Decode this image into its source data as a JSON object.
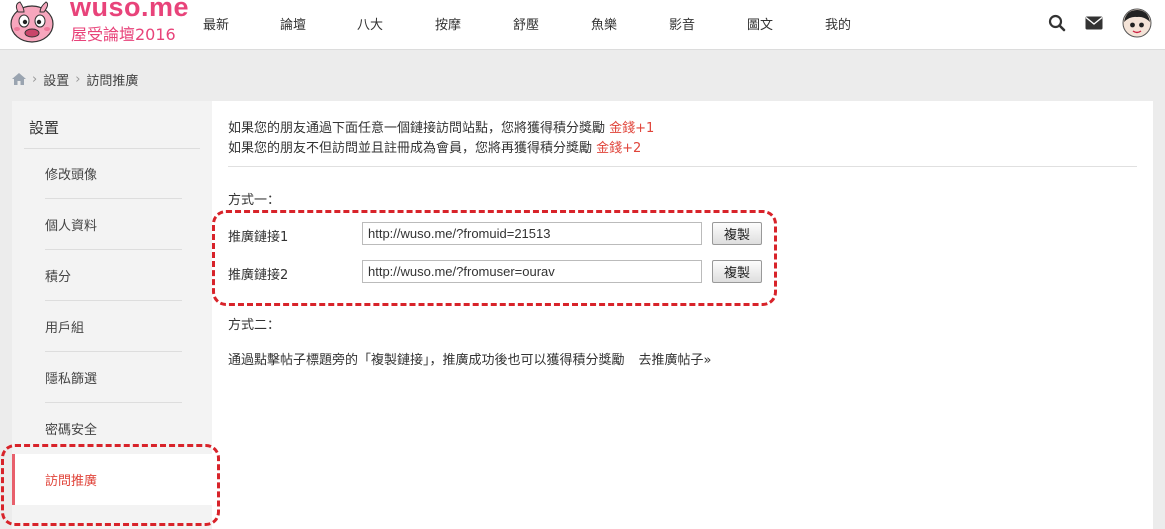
{
  "header": {
    "logo_text": "wuso.me",
    "logo_tagline": "屋受論壇2016",
    "nav": [
      "最新",
      "論壇",
      "八大",
      "按摩",
      "舒壓",
      "魚樂",
      "影音",
      "圖文",
      "我的"
    ],
    "icons": [
      "search-icon",
      "mail-icon",
      "avatar"
    ]
  },
  "breadcrumb": {
    "home_icon": "home-icon",
    "items": [
      "設置",
      "訪問推廣"
    ]
  },
  "sidebar": {
    "title": "設置",
    "items": [
      "修改頭像",
      "個人資料",
      "積分",
      "用戶組",
      "隱私篩選",
      "密碼安全",
      "訪問推廣"
    ],
    "active": "訪問推廣"
  },
  "main": {
    "line1_text": "如果您的朋友通過下面任意一個鏈接訪問站點，您將獲得積分獎勵 ",
    "line1_reward": "金錢+1",
    "line2_text": "如果您的朋友不但訪問並且註冊成為會員，您將再獲得積分獎勵 ",
    "line2_reward": "金錢+2",
    "method1_label": "方式一：",
    "links": [
      {
        "label": "推廣鏈接1",
        "value": "http://wuso.me/?fromuid=21513",
        "button": "複製"
      },
      {
        "label": "推廣鏈接2",
        "value": "http://wuso.me/?fromuser=ourav",
        "button": "複製"
      }
    ],
    "method2_label": "方式二：",
    "method2_desc": "通過點擊帖子標題旁的「複製鏈接」，推廣成功後也可以獲得積分獎勵",
    "method2_link": "去推廣帖子»"
  },
  "colors": {
    "brand": "#e8437a",
    "reward": "#e0443a",
    "annotation": "#d8232a"
  }
}
